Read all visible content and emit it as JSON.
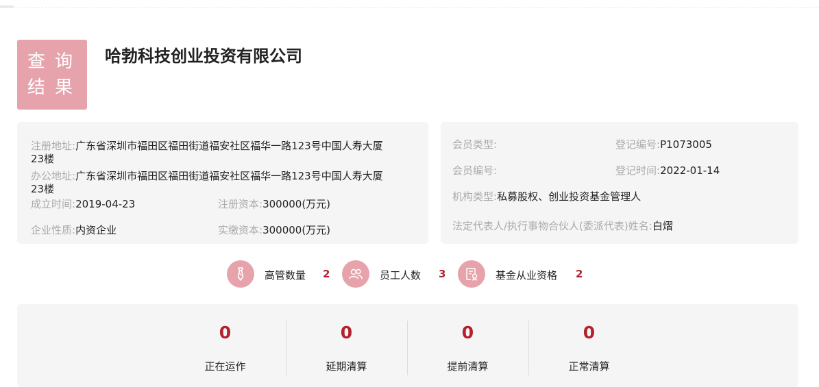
{
  "header": {
    "badge_chars": [
      "查",
      "询",
      "结",
      "果"
    ],
    "company_name": "哈勃科技创业投资有限公司"
  },
  "basic_info": {
    "reg_address": {
      "label": "注册地址:",
      "value": "广东省深圳市福田区福田街道福安社区福华一路123号中国人寿大厦",
      "value_wrap": "23楼"
    },
    "office_address": {
      "label": "办公地址:",
      "value": "广东省深圳市福田区福田街道福安社区福华一路123号中国人寿大厦",
      "value_wrap": "23楼"
    },
    "established": {
      "label": "成立时间:",
      "value": "2019-04-23"
    },
    "reg_capital": {
      "label": "注册资本:",
      "value": "300000(万元)"
    },
    "nature": {
      "label": "企业性质:",
      "value": "内资企业"
    },
    "paid_capital": {
      "label": "实缴资本:",
      "value": "300000(万元)"
    }
  },
  "member_info": {
    "member_type": {
      "label": "会员类型:",
      "value": ""
    },
    "reg_no": {
      "label": "登记编号:",
      "value": "P1073005"
    },
    "member_no": {
      "label": "会员编号:",
      "value": ""
    },
    "reg_date": {
      "label": "登记时间:",
      "value": "2022-01-14"
    },
    "org_type": {
      "label": "机构类型:",
      "value": "私募股权、创业投资基金管理人"
    },
    "legal_rep": {
      "label": "法定代表人/执行事物合伙人(委派代表)姓名:",
      "value": "白熠"
    }
  },
  "stats": [
    {
      "icon": "tie-icon",
      "label": "高管数量",
      "value": "2"
    },
    {
      "icon": "people-icon",
      "label": "员工人数",
      "value": "3"
    },
    {
      "icon": "certificate-icon",
      "label": "基金从业资格",
      "value": "2"
    }
  ],
  "fund_status": [
    {
      "value": "0",
      "label": "正在运作"
    },
    {
      "value": "0",
      "label": "延期清算"
    },
    {
      "value": "0",
      "label": "提前清算"
    },
    {
      "value": "0",
      "label": "正常清算"
    }
  ],
  "colors": {
    "accent_pink": "#e6a3ac",
    "value_red": "#b3222c",
    "card_bg": "#f5f5f5",
    "label_gray": "#aaaaaa"
  }
}
